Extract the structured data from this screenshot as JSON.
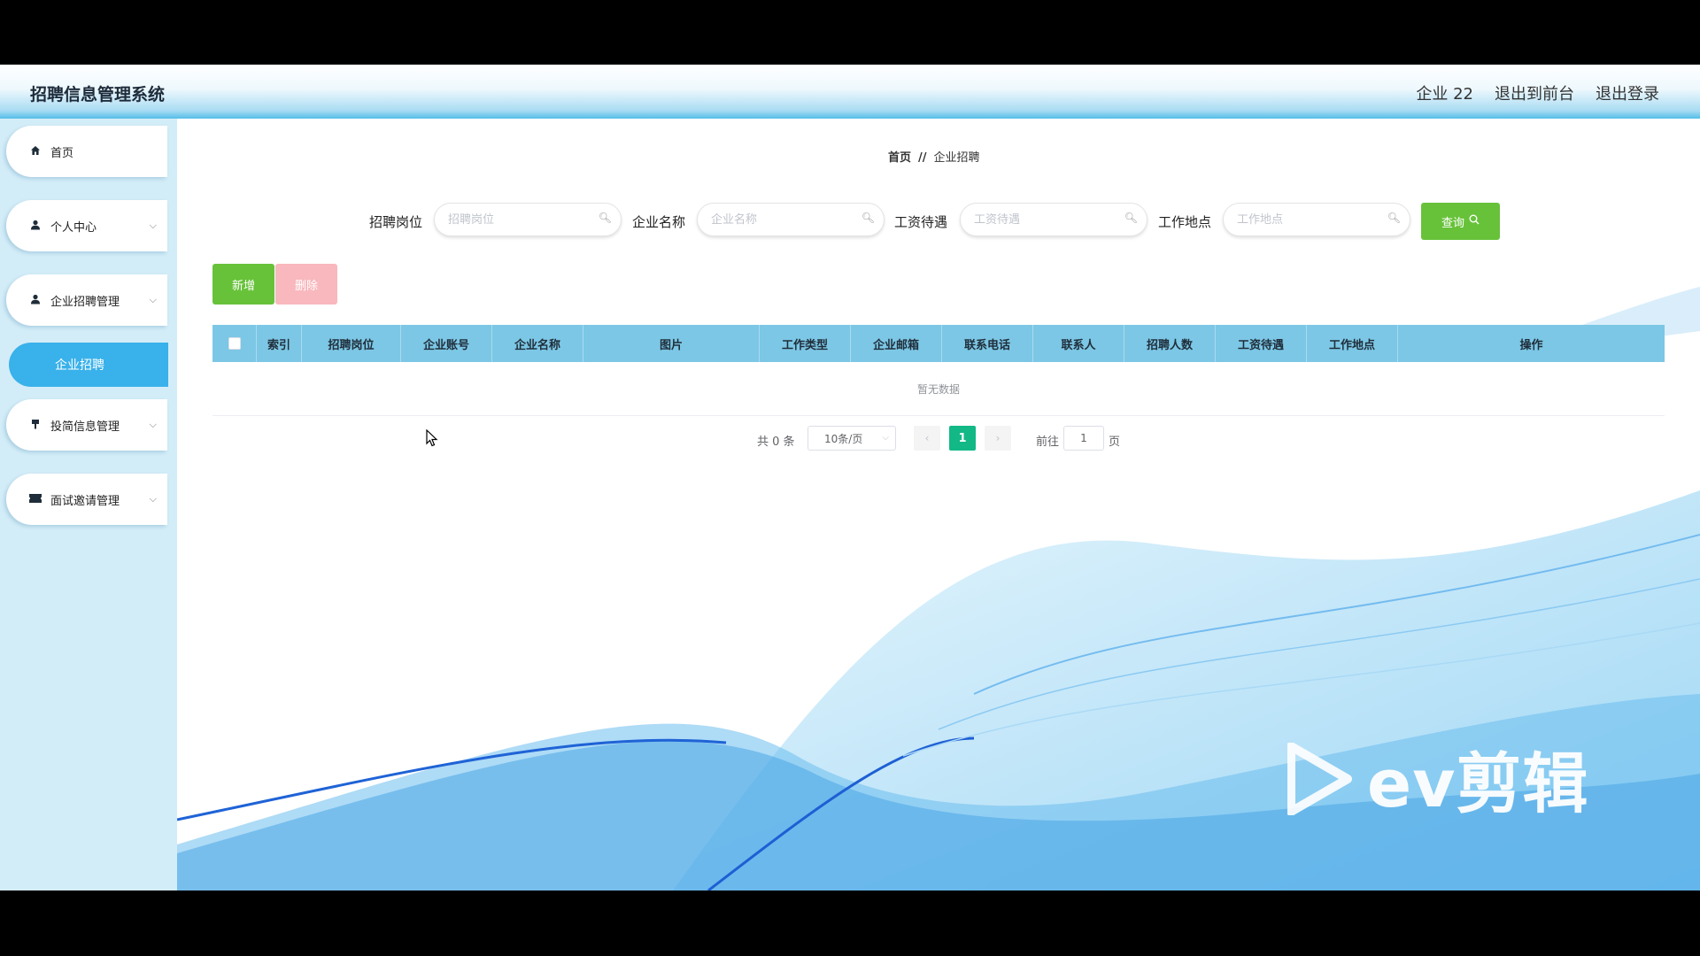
{
  "header": {
    "title": "招聘信息管理系统",
    "user": "企业 22",
    "front_link": "退出到前台",
    "logout_link": "退出登录"
  },
  "sidebar": {
    "items": [
      {
        "label": "首页",
        "icon": "home-icon"
      },
      {
        "label": "个人中心",
        "icon": "user-icon"
      },
      {
        "label": "企业招聘管理",
        "icon": "user-icon"
      },
      {
        "label": "投简信息管理",
        "icon": "pin-icon"
      },
      {
        "label": "面试邀请管理",
        "icon": "ticket-icon"
      }
    ],
    "active_sub": "企业招聘"
  },
  "breadcrumb": {
    "home": "首页",
    "sep": "//",
    "current": "企业招聘"
  },
  "search": {
    "fields": [
      {
        "label": "招聘岗位",
        "placeholder": "招聘岗位"
      },
      {
        "label": "企业名称",
        "placeholder": "企业名称"
      },
      {
        "label": "工资待遇",
        "placeholder": "工资待遇"
      },
      {
        "label": "工作地点",
        "placeholder": "工作地点"
      }
    ],
    "query_label": "查询"
  },
  "actions": {
    "add_label": "新增",
    "delete_label": "删除"
  },
  "table": {
    "columns": [
      "索引",
      "招聘岗位",
      "企业账号",
      "企业名称",
      "图片",
      "工作类型",
      "企业邮箱",
      "联系电话",
      "联系人",
      "招聘人数",
      "工资待遇",
      "工作地点",
      "操作"
    ],
    "empty_text": "暂无数据"
  },
  "pagination": {
    "total": "共 0 条",
    "page_size": "10条/页",
    "current_page": "1",
    "goto_label": "前往",
    "goto_value": "1",
    "page_suffix": "页"
  },
  "watermark": {
    "text": "ev剪辑"
  },
  "colors": {
    "accent": "#39b1ea",
    "success": "#67c23a",
    "danger_light": "#f8b8bd",
    "table_header": "#7cc7e5",
    "page_active": "#12b886"
  }
}
